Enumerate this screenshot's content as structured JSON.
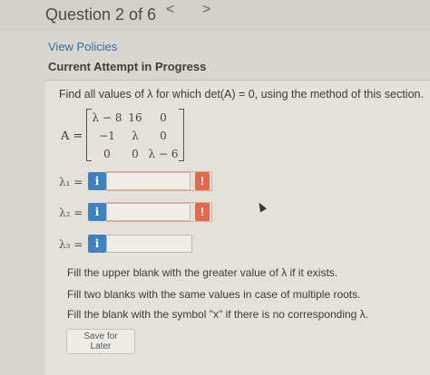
{
  "header": {
    "question_title": "Question 2 of 6",
    "prev_glyph": "<",
    "next_glyph": ">"
  },
  "links": {
    "view_policies": "View Policies"
  },
  "attempt": {
    "heading": "Current Attempt in Progress"
  },
  "problem": {
    "prompt": "Find all values of λ for which det(A) = 0, using the method of this section.",
    "matrix_label": "A =",
    "matrix": [
      [
        "λ − 8",
        "16",
        "0"
      ],
      [
        "−1",
        "λ",
        "0"
      ],
      [
        "0",
        "0",
        "λ − 6"
      ]
    ]
  },
  "answers": [
    {
      "label": "λ₁ =",
      "info": "i",
      "value": "",
      "error": "!"
    },
    {
      "label": "λ₂ =",
      "info": "i",
      "value": "",
      "error": "!"
    },
    {
      "label": "λ₃ =",
      "info": "i",
      "value": "",
      "error": ""
    }
  ],
  "hints": [
    "Fill the upper blank with the greater value of λ if it exists.",
    "Fill two blanks with the same values in case of multiple roots.",
    "Fill the blank with the symbol \"x\" if there is no corresponding λ."
  ],
  "actions": {
    "save_label": "Save for Later"
  },
  "colors": {
    "link": "#3a6aa8",
    "info_button": "#3e82bf",
    "error_badge": "#e06a4f"
  }
}
